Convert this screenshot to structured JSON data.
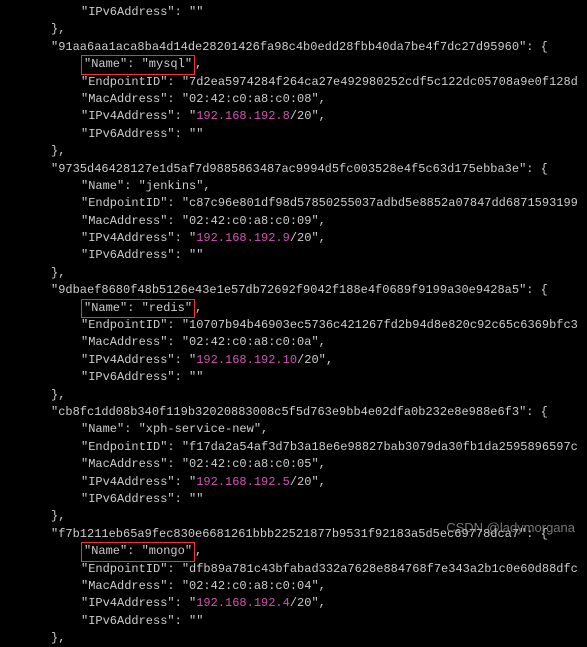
{
  "entries": [
    {
      "lead_line": "\"IPv6Address\": \"\"",
      "hash": "91aa6aa1aca8ba4d14de28201426fa98c4b0edd28fbb40da7be4f7dc27d95960",
      "highlight_name": true,
      "name": "mysql",
      "endpoint_id": "7d2ea5974284f264ca27e492980252cdf5c122dc05708a9e0f128d",
      "mac": "02:42:c0:a8:c0:08",
      "ipv4_ip": "192.168.192.8",
      "ipv4_cidr": "20",
      "ipv6": ""
    },
    {
      "lead_line": null,
      "hash": "9735d46428127e1d5af7d9885863487ac9994d5fc003528e4f5c63d175ebba3e",
      "highlight_name": false,
      "name": "jenkins",
      "endpoint_id": "c87c96e801df98d57850255037adbd5e8852a07847dd6871593199",
      "mac": "02:42:c0:a8:c0:09",
      "ipv4_ip": "192.168.192.9",
      "ipv4_cidr": "20",
      "ipv6": ""
    },
    {
      "lead_line": null,
      "hash": "9dbaef8680f48b5126e43e1e57db72692f9042f188e4f0689f9199a30e9428a5",
      "highlight_name": true,
      "name": "redis",
      "endpoint_id": "10707b94b46903ec5736c421267fd2b94d8e820c92c65c6369bfc3",
      "mac": "02:42:c0:a8:c0:0a",
      "ipv4_ip": "192.168.192.10",
      "ipv4_cidr": "20",
      "ipv6": ""
    },
    {
      "lead_line": null,
      "hash": "cb8fc1dd08b340f119b32020883008c5f5d763e9bb4e02dfa0b232e8e988e6f3",
      "highlight_name": false,
      "name": "xph-service-new",
      "endpoint_id": "f17da2a54af3d7b3a18e6e98827bab3079da30fb1da2595896597c",
      "mac": "02:42:c0:a8:c0:05",
      "ipv4_ip": "192.168.192.5",
      "ipv4_cidr": "20",
      "ipv6": ""
    },
    {
      "lead_line": null,
      "hash": "f7b1211eb65a9fec830e6681261bbb22521877b9531f92183a5d5ec69778dca7",
      "highlight_name": true,
      "name": "mongo",
      "endpoint_id": "dfb89a781c43bfabad332a7628e884768f7e343a2b1c0e60d88dfc",
      "mac": "02:42:c0:a8:c0:04",
      "ipv4_ip": "192.168.192.4",
      "ipv4_cidr": "20",
      "ipv6": ""
    }
  ],
  "watermark": "CSDN @ladymorgana"
}
